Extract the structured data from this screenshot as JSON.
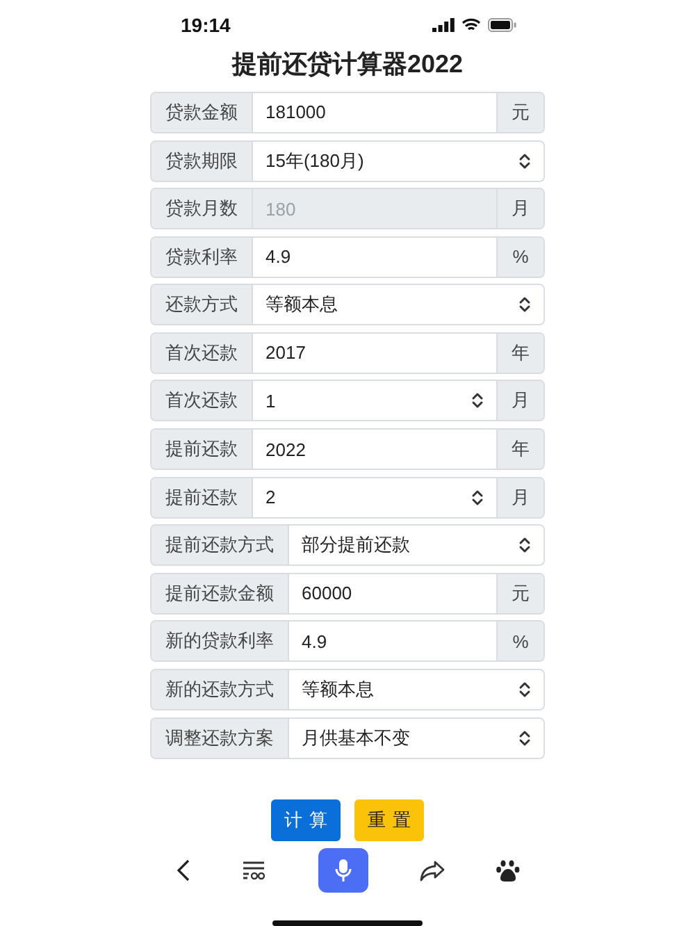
{
  "status_bar": {
    "time": "19:14"
  },
  "title": "提前还贷计算器2022",
  "rows": [
    {
      "label": "贷款金额",
      "kind": "input",
      "value": "181000",
      "suffix": "元",
      "disabled": false
    },
    {
      "label": "贷款期限",
      "kind": "select",
      "value": "15年(180月)",
      "disabled": false
    },
    {
      "label": "贷款月数",
      "kind": "input",
      "value": "180",
      "suffix": "月",
      "disabled": true
    },
    {
      "label": "贷款利率",
      "kind": "input",
      "value": "4.9",
      "suffix": "%",
      "disabled": false
    },
    {
      "label": "还款方式",
      "kind": "select",
      "value": "等额本息",
      "disabled": false
    },
    {
      "label": "首次还款",
      "kind": "input",
      "value": "2017",
      "suffix": "年",
      "disabled": false
    },
    {
      "label": "首次还款",
      "kind": "select",
      "value": "1",
      "suffix": "月",
      "disabled": false
    },
    {
      "label": "提前还款",
      "kind": "input",
      "value": "2022",
      "suffix": "年",
      "disabled": false
    },
    {
      "label": "提前还款",
      "kind": "select",
      "value": "2",
      "suffix": "月",
      "disabled": false
    },
    {
      "label": "提前还款方式",
      "kind": "select",
      "value": "部分提前还款",
      "disabled": false
    },
    {
      "label": "提前还款金额",
      "kind": "input",
      "value": "60000",
      "suffix": "元",
      "disabled": false
    },
    {
      "label": "新的贷款利率",
      "kind": "input",
      "value": "4.9",
      "suffix": "%",
      "disabled": false
    },
    {
      "label": "新的还款方式",
      "kind": "select",
      "value": "等额本息",
      "disabled": false
    },
    {
      "label": "调整还款方案",
      "kind": "select",
      "value": "月供基本不变",
      "disabled": false
    }
  ],
  "buttons": [
    {
      "label": "计算",
      "kind": "primary"
    },
    {
      "label": "重置",
      "kind": "warning"
    }
  ]
}
